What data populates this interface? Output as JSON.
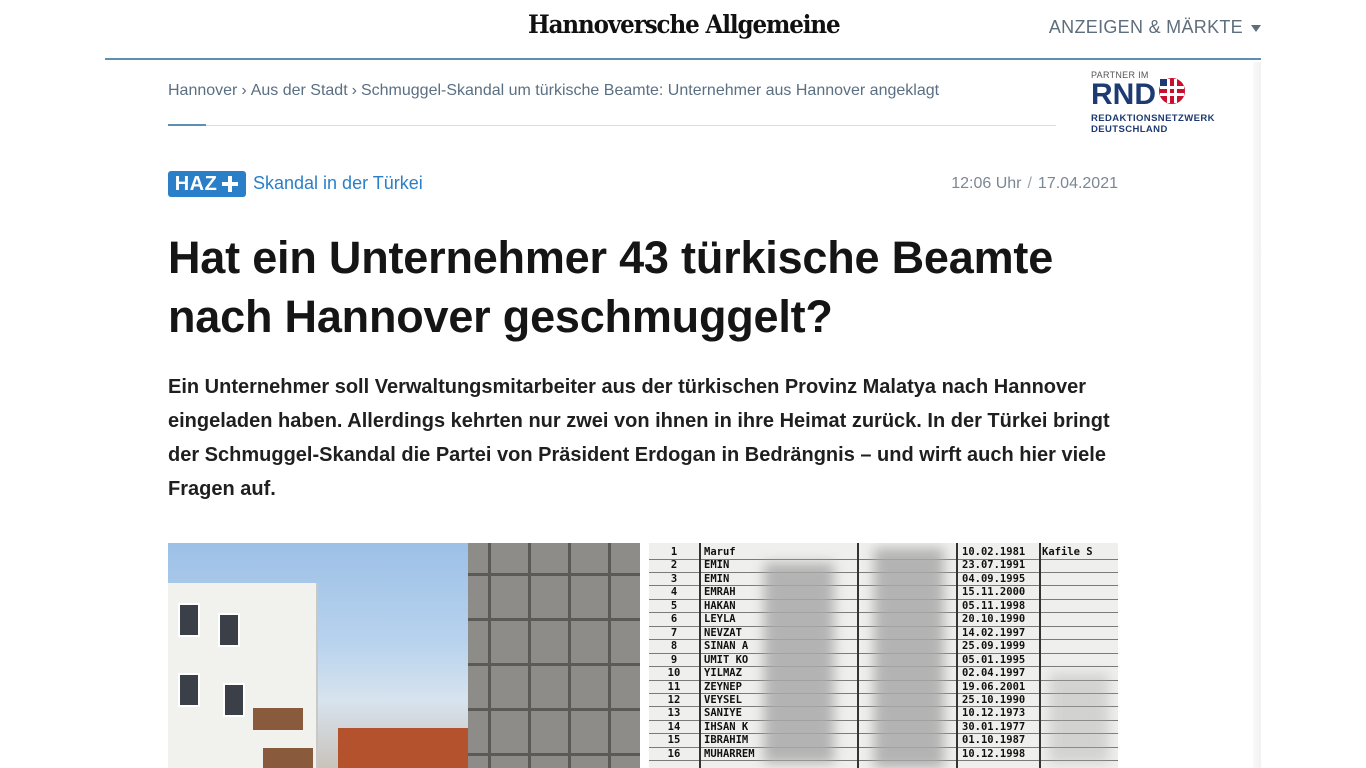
{
  "header": {
    "logo": "Hannoversche Allgemeine",
    "nav_label": "ANZEIGEN & MÄRKTE"
  },
  "breadcrumb": {
    "items": [
      "Hannover",
      "Aus der Stadt",
      "Schmuggel-Skandal um türkische Beamte: Unternehmer aus Hannover angeklagt"
    ],
    "separator": "›"
  },
  "partner": {
    "small": "PARTNER IM",
    "logo": "RND",
    "sub_line1": "REDAKTIONSNETZWERK",
    "sub_line2": "DEUTSCHLAND"
  },
  "article": {
    "badge": "HAZ",
    "kicker": "Skandal in der Türkei",
    "time": "12:06 Uhr",
    "date_separator": "/",
    "date": "17.04.2021",
    "headline": "Hat ein Unternehmer 43 türkische Beamte nach Hannover geschmuggelt?",
    "teaser": "Ein Unternehmer soll Verwaltungsmitarbeiter aus der türkischen Provinz Malatya nach Hannover eingeladen haben. Allerdings kehrten nur zwei von ihnen in ihre Heimat zurück. In der Türkei bringt der Schmuggel-Skandal die Partei von Präsident Erdogan in Bedrängnis – und wirft auch hier viele Fragen auf."
  },
  "document": {
    "rows": [
      {
        "num": "1",
        "name": "Maruf",
        "date": "10.02.1981",
        "extra": "Kafile S"
      },
      {
        "num": "2",
        "name": "EMIN",
        "date": "23.07.1991",
        "extra": ""
      },
      {
        "num": "3",
        "name": "EMIN",
        "date": "04.09.1995",
        "extra": ""
      },
      {
        "num": "4",
        "name": "EMRAH",
        "date": "15.11.2000",
        "extra": ""
      },
      {
        "num": "5",
        "name": "HAKAN",
        "date": "05.11.1998",
        "extra": ""
      },
      {
        "num": "6",
        "name": "LEYLA",
        "date": "20.10.1990",
        "extra": ""
      },
      {
        "num": "7",
        "name": "NEVZAT",
        "date": "14.02.1997",
        "extra": ""
      },
      {
        "num": "8",
        "name": "SINAN A",
        "date": "25.09.1999",
        "extra": ""
      },
      {
        "num": "9",
        "name": "UMIT KO",
        "date": "05.01.1995",
        "extra": ""
      },
      {
        "num": "10",
        "name": "YILMAZ",
        "date": "02.04.1997",
        "extra": ""
      },
      {
        "num": "11",
        "name": "ZEYNEP",
        "date": "19.06.2001",
        "extra": ""
      },
      {
        "num": "12",
        "name": "VEYSEL",
        "date": "25.10.1990",
        "extra": ""
      },
      {
        "num": "13",
        "name": "SANIYE",
        "date": "10.12.1973",
        "extra": ""
      },
      {
        "num": "14",
        "name": "IHSAN K",
        "date": "30.01.1977",
        "extra": ""
      },
      {
        "num": "15",
        "name": "IBRAHIM",
        "date": "01.10.1987",
        "extra": ""
      },
      {
        "num": "16",
        "name": "MUHARREM",
        "date": "10.12.1998",
        "extra": ""
      }
    ]
  },
  "colors": {
    "accent": "#2a7fc8",
    "header_rule": "#5d8fb5",
    "rnd_blue": "#1d3a72",
    "rnd_red": "#c8102e"
  },
  "icons": {
    "nav_caret": "caret-down-icon",
    "badge_plus": "plus-icon",
    "rnd_mark": "rnd-grid-icon"
  }
}
